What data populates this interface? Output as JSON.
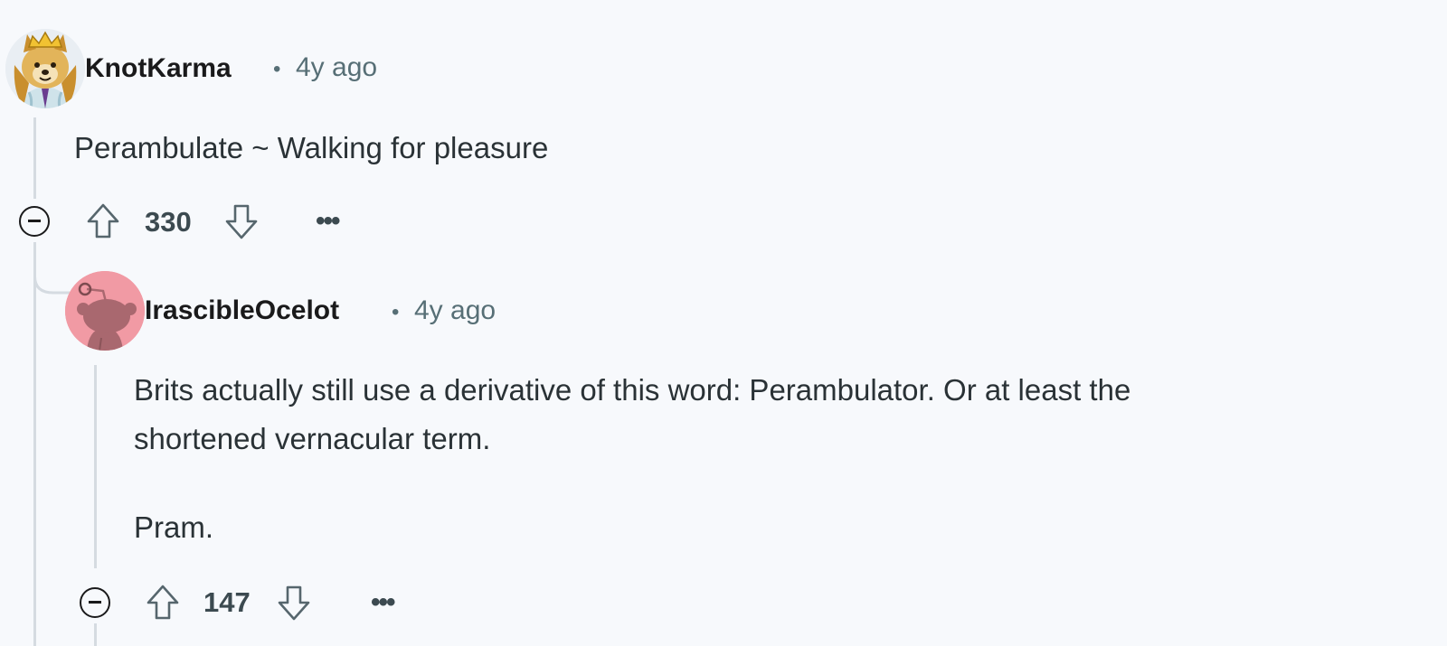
{
  "comments": [
    {
      "username": "KnotKarma",
      "separator": "•",
      "time": "4y ago",
      "body": [
        "Perambulate ~ Walking for pleasure"
      ],
      "score": "330",
      "more": "•••",
      "icons": {
        "avatar": "doge-avatar",
        "collapse": "collapse-minus-icon",
        "upvote": "arrow-up-icon",
        "downvote": "arrow-down-icon",
        "more": "more-dots-icon"
      }
    },
    {
      "username": "IrascibleOcelot",
      "separator": "•",
      "time": "4y ago",
      "body": [
        "Brits actually still use a derivative of this word: Perambulator. Or at least the",
        "shortened vernacular term.",
        "Pram."
      ],
      "score": "147",
      "more": "•••",
      "icons": {
        "avatar": "snoo-avatar",
        "collapse": "collapse-minus-icon",
        "upvote": "arrow-up-icon",
        "downvote": "arrow-down-icon",
        "more": "more-dots-icon"
      }
    }
  ],
  "colors": {
    "background": "#f7f9fc",
    "text": "#2a3236",
    "meta": "#576f76",
    "thread": "#d5dbe1",
    "snoo_bg": "#f19aa4"
  }
}
